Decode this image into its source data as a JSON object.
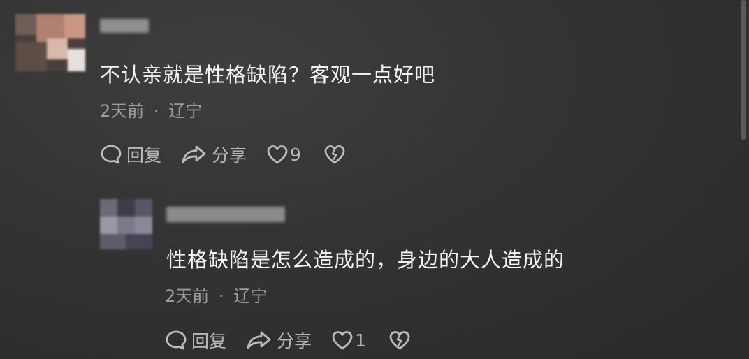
{
  "comments": [
    {
      "content": "不认亲就是性格缺陷？客观一点好吧",
      "time": "2天前",
      "separator": "·",
      "location": "辽宁",
      "reply_label": "回复",
      "share_label": "分享",
      "like_count": "9",
      "avatar_colors": [
        "#6f5e57",
        "#b08070",
        "#d8b8a8",
        "#caa090",
        "#8a6d64",
        "#a07868"
      ]
    },
    {
      "content": "性格缺陷是怎么造成的，身边的大人造成的",
      "time": "2天前",
      "separator": "·",
      "location": "辽宁",
      "reply_label": "回复",
      "share_label": "分享",
      "like_count": "1",
      "avatar_colors": [
        "#6b6b78",
        "#8a8898",
        "#5a5668",
        "#7c7888",
        "#464452",
        "#9a96a6"
      ]
    }
  ]
}
